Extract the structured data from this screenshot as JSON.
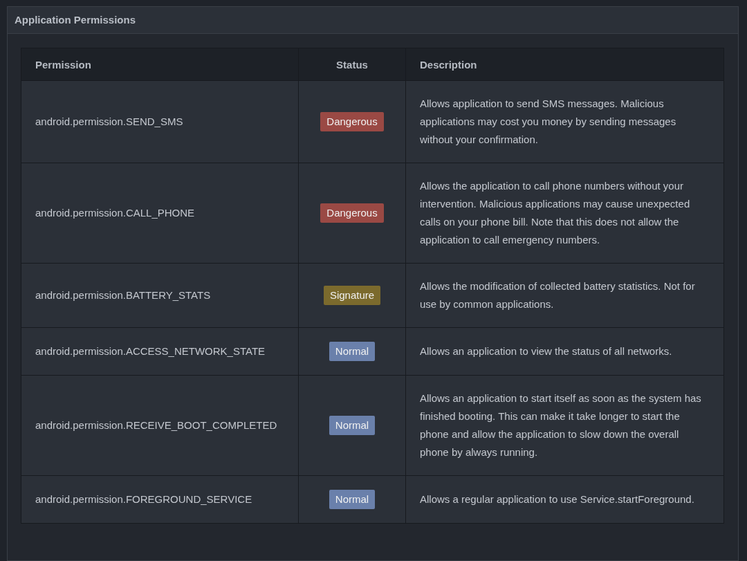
{
  "panel": {
    "title": "Application Permissions"
  },
  "table": {
    "columns": [
      "Permission",
      "Status",
      "Description"
    ],
    "rows": [
      {
        "permission": "android.permission.SEND_SMS",
        "status": {
          "label": "Dangerous",
          "kind": "dangerous"
        },
        "description": "Allows application to send SMS messages. Malicious applications may cost you money by sending messages without your confirmation."
      },
      {
        "permission": "android.permission.CALL_PHONE",
        "status": {
          "label": "Dangerous",
          "kind": "dangerous"
        },
        "description": "Allows the application to call phone numbers without your intervention. Malicious applications may cause unexpected calls on your phone bill. Note that this does not allow the application to call emergency numbers."
      },
      {
        "permission": "android.permission.BATTERY_STATS",
        "status": {
          "label": "Signature",
          "kind": "signature"
        },
        "description": "Allows the modification of collected battery statistics. Not for use by common applications."
      },
      {
        "permission": "android.permission.ACCESS_NETWORK_STATE",
        "status": {
          "label": "Normal",
          "kind": "normal"
        },
        "description": "Allows an application to view the status of all networks."
      },
      {
        "permission": "android.permission.RECEIVE_BOOT_COMPLETED",
        "status": {
          "label": "Normal",
          "kind": "normal"
        },
        "description": "Allows an application to start itself as soon as the system has finished booting. This can make it take longer to start the phone and allow the application to slow down the overall phone by always running."
      },
      {
        "permission": "android.permission.FOREGROUND_SERVICE",
        "status": {
          "label": "Normal",
          "kind": "normal"
        },
        "description": "Allows a regular application to use Service.startForeground."
      }
    ]
  }
}
